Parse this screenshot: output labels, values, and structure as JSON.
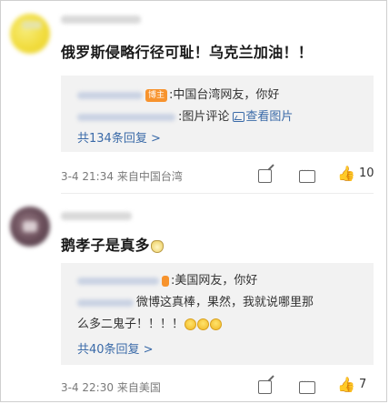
{
  "comments": [
    {
      "text": "俄罗斯侵略行径可耻！乌克兰加油！！",
      "quote": {
        "author_tag": "博主",
        "line1": ":中国台湾网友，你好",
        "line2_text": ":图片评论",
        "view_image": "查看图片",
        "replies": "共134条回复 >"
      },
      "time": "3-4 21:34",
      "location": "来自中国台湾",
      "likes": "10"
    },
    {
      "text": "鹅孝子是真多",
      "quote": {
        "line1": ":美国网友，你好",
        "line2": "微博这真棒，果然，我就说哪里那",
        "line3": "么多二鬼子！！！！",
        "replies": "共40条回复 >"
      },
      "time": "3-4 22:30",
      "location": "来自美国",
      "likes": "7"
    }
  ],
  "icons": {
    "share": "share-icon",
    "comment": "comment-icon",
    "like": "thumbs-up-icon"
  },
  "colors": {
    "link": "#3a6aa8",
    "tag": "#f7932d",
    "quote_bg": "#f2f2f2"
  }
}
